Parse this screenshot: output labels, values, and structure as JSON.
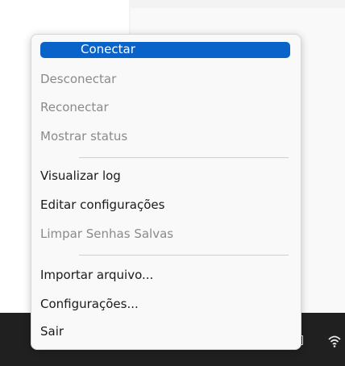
{
  "menu": {
    "items": [
      {
        "label": "Conectar",
        "state": "selected"
      },
      {
        "label": "Desconectar",
        "state": "disabled"
      },
      {
        "label": "Reconectar",
        "state": "disabled"
      },
      {
        "label": "Mostrar status",
        "state": "disabled"
      },
      {
        "label": "Visualizar log",
        "state": "enabled"
      },
      {
        "label": "Editar configurações",
        "state": "enabled"
      },
      {
        "label": "Limpar Senhas Salvas",
        "state": "disabled"
      },
      {
        "label": "Importar arquivo...",
        "state": "enabled"
      },
      {
        "label": "Configurações...",
        "state": "enabled"
      },
      {
        "label": "Sair",
        "state": "enabled"
      }
    ]
  },
  "colors": {
    "selected_bg": "#0a63c9",
    "menu_bg": "#f9f9f9",
    "taskbar_bg": "#202020",
    "disabled_text": "#8a8a8a"
  },
  "tray": {
    "icons": [
      "window-icon",
      "wifi-icon"
    ]
  }
}
